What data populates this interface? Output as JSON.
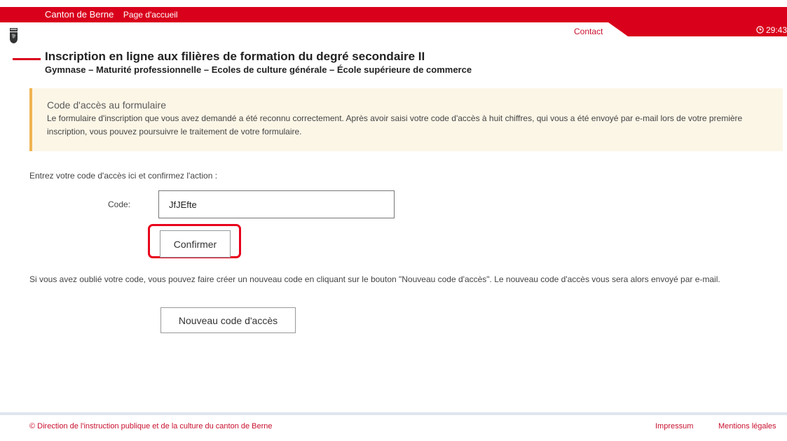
{
  "header": {
    "brand": "Canton de Berne",
    "home_link": "Page d'accueil",
    "contact_link": "Contact",
    "timer": "29:43",
    "clock_icon": "clock-icon",
    "logo_icon": "bern-coat-of-arms-icon"
  },
  "page": {
    "title": "Inscription en ligne aux filières de formation du degré secondaire II",
    "subtitle": "Gymnase – Maturité professionnelle – Ecoles de culture générale – École supérieure de commerce"
  },
  "notice": {
    "title": "Code d'accès au formulaire",
    "text": "Le formulaire d'inscription que vous avez demandé a été reconnu correctement. Après avoir saisi votre code d'accès à huit chiffres, qui vous a été envoyé par e-mail lors de votre première inscription, vous pouvez poursuivre le traitement de votre formulaire."
  },
  "form": {
    "instruction": "Entrez votre code d'accès ici et confirmez l'action :",
    "code_label": "Code:",
    "code_value": "JfJEfte",
    "confirm_label": "Confirmer",
    "forgot_text": "Si vous avez oublié votre code, vous pouvez faire créer un nouveau code en cliquant sur le bouton \"Nouveau code d'accès\". Le nouveau code d'accès vous sera alors envoyé par e-mail.",
    "new_code_label": "Nouveau code d'accès"
  },
  "footer": {
    "copyright": "© Direction de l'instruction publique et de la culture du canton de Berne",
    "impressum": "Impressum",
    "legal": "Mentions légales"
  },
  "colors": {
    "brand_red": "#d9001b",
    "notice_bg": "#fcf6e7",
    "notice_accent": "#f0b352",
    "highlight": "#e8001c"
  }
}
